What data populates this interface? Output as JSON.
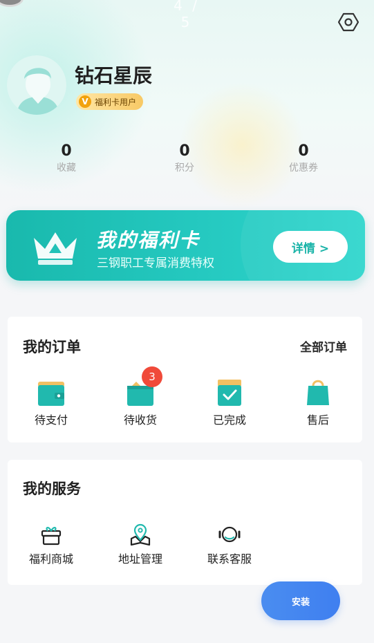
{
  "header": {
    "page_indicator": "4 / 5",
    "settings_icon": "settings-hex-icon"
  },
  "profile": {
    "username": "钻石星辰",
    "badge_letter": "V",
    "badge_label": "福利卡用户",
    "avatar_icon": "default-avatar-icon"
  },
  "stats": [
    {
      "value": "0",
      "label": "收藏"
    },
    {
      "value": "0",
      "label": "积分"
    },
    {
      "value": "0",
      "label": "优惠券"
    }
  ],
  "welfare_card": {
    "title": "我的福利卡",
    "subtitle": "三钢职工专属消费特权",
    "detail_button": "详情 >",
    "icon": "crown-icon"
  },
  "orders": {
    "title": "我的订单",
    "all_link": "全部订单",
    "items": [
      {
        "label": "待支付",
        "icon": "wallet-icon",
        "badge": ""
      },
      {
        "label": "待收货",
        "icon": "package-icon",
        "badge": "3"
      },
      {
        "label": "已完成",
        "icon": "box-check-icon",
        "badge": ""
      },
      {
        "label": "售后",
        "icon": "shopping-bag-icon",
        "badge": ""
      }
    ]
  },
  "services": {
    "title": "我的服务",
    "items": [
      {
        "label": "福利商城",
        "icon": "gift-icon"
      },
      {
        "label": "地址管理",
        "icon": "map-pin-icon"
      },
      {
        "label": "联系客服",
        "icon": "headset-icon"
      }
    ]
  },
  "install_button": "安装",
  "colors": {
    "accent": "#1ebdb2",
    "badge_red": "#f04a3a",
    "install_blue": "#4a8df0"
  }
}
